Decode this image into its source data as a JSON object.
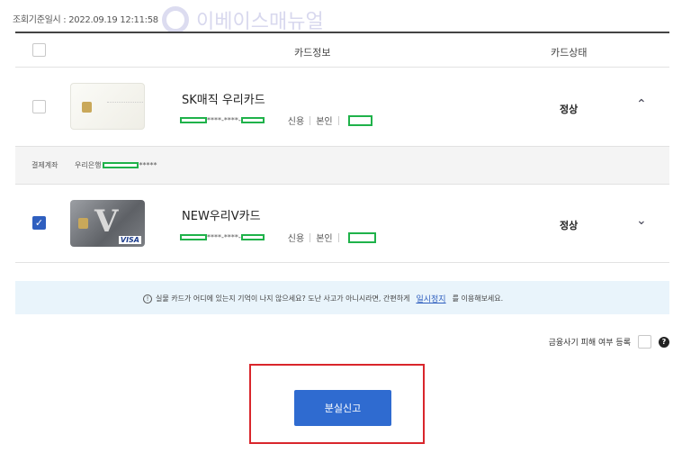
{
  "query_time": "조회기준일시 : 2022.09.19 12:11:58",
  "watermark_text": "이베이스매뉴얼",
  "table": {
    "header_card_info": "카드정보",
    "header_card_status": "카드상태"
  },
  "cards": [
    {
      "name": "SK매직 우리카드",
      "mask_text": "****-****-",
      "type": "신용",
      "owner": "본인",
      "status": "정상",
      "checked": false,
      "expanded": true
    },
    {
      "name": "NEW우리V카드",
      "mask_text": "****-****-",
      "type": "신용",
      "owner": "본인",
      "status": "정상",
      "checked": true,
      "expanded": false,
      "brand": "VISA"
    }
  ],
  "account": {
    "label": "결제계좌",
    "bank": "우리은행",
    "mask_suffix": "*****"
  },
  "notice": {
    "before": "실물 카드가 어디에 있는지 기억이 나지 않으세요? 도난 사고가 아니시라면, 간편하게",
    "link": "일시정지",
    "after": "를 이용해보세요."
  },
  "fraud": {
    "label": "금융사기 피해 여부 등록",
    "help": "?"
  },
  "submit_label": "분실신고",
  "colors": {
    "accent": "#2f6bd0",
    "highlight_box": "#d9262c",
    "mask_box": "#1fb24a"
  }
}
